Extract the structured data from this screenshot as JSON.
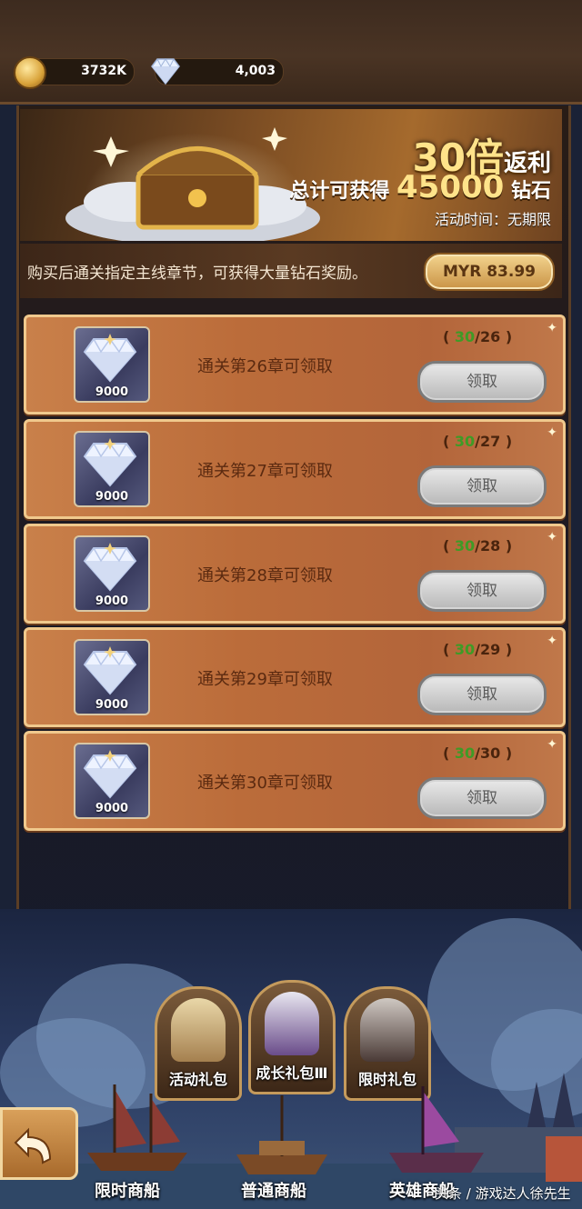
{
  "currency": {
    "gold": "3732K",
    "diamonds": "4,003"
  },
  "banner": {
    "multiplier": "30倍",
    "multiplier_suffix": "返利",
    "total_prefix": "总计可获得",
    "total_amount": "45000",
    "total_unit": "钻石",
    "time": "活动时间：无期限"
  },
  "description": "购买后通关指定主线章节，可获得大量钻石奖励。",
  "price": "MYR 83.99",
  "rewards": [
    {
      "amount": "9000",
      "label": "通关第26章可领取",
      "progress_done": "30",
      "progress_total": "/26",
      "button": "领取"
    },
    {
      "amount": "9000",
      "label": "通关第27章可领取",
      "progress_done": "30",
      "progress_total": "/27",
      "button": "领取"
    },
    {
      "amount": "9000",
      "label": "通关第28章可领取",
      "progress_done": "30",
      "progress_total": "/28",
      "button": "领取"
    },
    {
      "amount": "9000",
      "label": "通关第29章可领取",
      "progress_done": "30",
      "progress_total": "/29",
      "button": "领取"
    },
    {
      "amount": "9000",
      "label": "通关第30章可领取",
      "progress_done": "30",
      "progress_total": "/30",
      "button": "领取"
    }
  ],
  "packs": [
    "活动礼包",
    "成长礼包Ⅲ",
    "限时礼包"
  ],
  "ships": [
    "限时商船",
    "普通商船",
    "英雄商船"
  ],
  "watermark": "头条 / 游戏达人徐先生"
}
